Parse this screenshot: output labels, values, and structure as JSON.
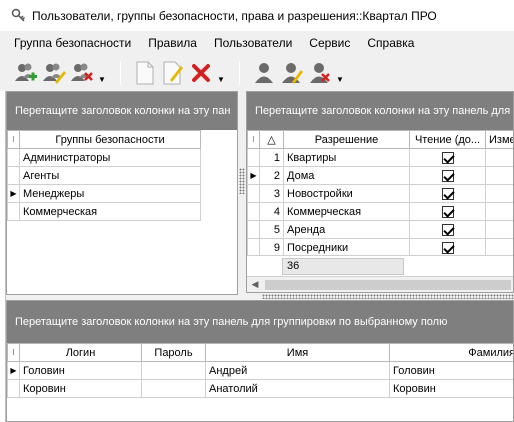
{
  "window": {
    "title": "Пользователи, группы безопасности, права и разрешения::Квартал ПРО"
  },
  "menu": [
    "Группа безопасности",
    "Правила",
    "Пользователи",
    "Сервис",
    "Справка"
  ],
  "colors": {
    "group_band": "#7f7f7f",
    "add_green": "#2e9e2e",
    "delete_red": "#d42020",
    "pencil_yellow": "#e8b800"
  },
  "toolbar": {
    "group1": [
      "add-group-icon",
      "edit-group-icon",
      "delete-group-icon"
    ],
    "group2": [
      "new-document-icon",
      "edit-document-icon",
      "delete-icon"
    ],
    "group3": [
      "user-icon",
      "edit-user-icon",
      "delete-user-icon"
    ]
  },
  "groups_panel": {
    "group_prompt": "Перетащите заголовок колонки на эту пан",
    "column": "Группы безопасности",
    "rows": [
      "Администраторы",
      "Агенты",
      "Менеджеры",
      "Коммерческая"
    ],
    "selected_index": 2
  },
  "perms_panel": {
    "group_prompt": "Перетащите заголовок колонки на эту панель для",
    "columns": [
      "△",
      "Разрешение",
      "Чтение (до...",
      "Изме"
    ],
    "rows": [
      {
        "id": "1",
        "name": "Квартиры",
        "read": true
      },
      {
        "id": "2",
        "name": "Дома",
        "read": true
      },
      {
        "id": "3",
        "name": "Новостройки",
        "read": true
      },
      {
        "id": "4",
        "name": "Коммерческая",
        "read": true
      },
      {
        "id": "5",
        "name": "Аренда",
        "read": true
      },
      {
        "id": "9",
        "name": "Посредники",
        "read": true
      }
    ],
    "selected_index": 1,
    "footer_count": "36"
  },
  "users_panel": {
    "group_prompt": "Перетащите заголовок колонки на эту панель для группировки по выбранному полю",
    "columns": [
      "Логин",
      "Пароль",
      "Имя",
      "Фамилия"
    ],
    "rows": [
      {
        "login": "Головин",
        "password": "",
        "name": "Андрей",
        "surname": "Головин"
      },
      {
        "login": "Коровин",
        "password": "",
        "name": "Анатолий",
        "surname": "Коровин"
      }
    ],
    "selected_index": 0
  }
}
